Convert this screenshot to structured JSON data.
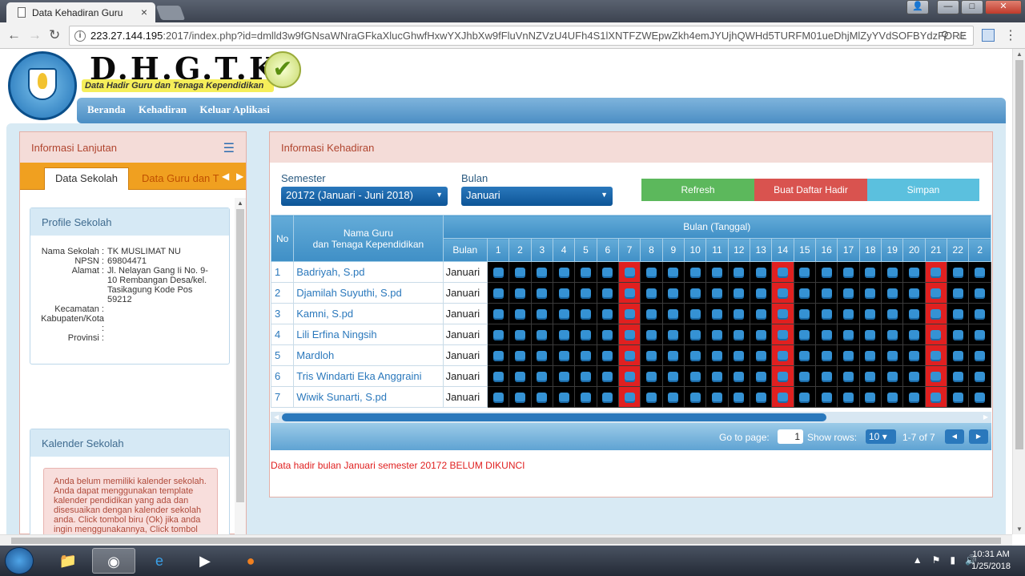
{
  "browser": {
    "tab_title": "Data Kehadiran Guru",
    "tab_close": "×",
    "url_host": "223.27.144.195",
    "url_rest": ":2017/index.php?id=dmlld3w9fGNsaWNraGFkaXlucGhwfHxwYXJhbXw9fFluVnNZVzU4UFh4S1lXNTFZWEpwZkh4emJYUjhQWHd5TURFM01ueDhjMlZyYVdSOFBYdzFORE",
    "window_min": "—",
    "window_max": "□",
    "window_close": "✕"
  },
  "header": {
    "brand_title": "D.H.G.T.K",
    "brand_subtitle": "Data Hadir Guru dan Tenaga Kependidikan",
    "nav": [
      "Beranda",
      "Kehadiran",
      "Keluar Aplikasi"
    ]
  },
  "left_panel": {
    "title": "Informasi Lanjutan",
    "tabs": [
      "Data Sekolah",
      "Data Guru dan T"
    ],
    "profile": {
      "title": "Profile Sekolah",
      "rows": [
        {
          "label": "Nama Sekolah :",
          "value": "TK MUSLIMAT NU"
        },
        {
          "label": "NPSN :",
          "value": "69804471"
        },
        {
          "label": "Alamat :",
          "value": "Jl. Nelayan Gang Ii No. 9-10 Rembangan Desa/kel. Tasikagung Kode Pos 59212"
        },
        {
          "label": "Kecamatan :",
          "value": ""
        },
        {
          "label": "Kabupaten/Kota :",
          "value": ""
        },
        {
          "label": "Provinsi :",
          "value": ""
        }
      ]
    },
    "calendar": {
      "title": "Kalender Sekolah",
      "alert": "Anda belum memiliki kalender sekolah. Anda dapat menggunakan template kalender pendidikan yang ada dan disesuaikan dengan kalender sekolah anda. Click tombol biru (Ok) jika anda ingin menggunakannya, Click tombol merah (Hapus) jika anda tidak mau menggunakannya."
    }
  },
  "right_panel": {
    "title": "Informasi Kehadiran",
    "semester_label": "Semester",
    "semester_value": "20172 (Januari - Juni 2018)",
    "bulan_label": "Bulan",
    "bulan_value": "Januari",
    "buttons": {
      "refresh": "Refresh",
      "buat": "Buat Daftar Hadir",
      "simpan": "Simpan"
    },
    "colors": {
      "refresh": "#5cb85c",
      "buat": "#d9534f",
      "simpan": "#5bc0de",
      "holiday": "#e02020",
      "present_dot": "#3592d4"
    },
    "grid": {
      "col_no": "No",
      "col_name_1": "Nama Guru",
      "col_name_2": "dan Tenaga Kependidikan",
      "col_bulan_group": "Bulan (Tanggal)",
      "col_bulan": "Bulan",
      "days": [
        "1",
        "2",
        "3",
        "4",
        "5",
        "6",
        "7",
        "8",
        "9",
        "10",
        "11",
        "12",
        "13",
        "14",
        "15",
        "16",
        "17",
        "18",
        "19",
        "20",
        "21",
        "22",
        "2"
      ],
      "holiday_days": [
        7,
        14,
        21
      ],
      "rows": [
        {
          "no": "1",
          "name": "Badriyah, S.pd",
          "bulan": "Januari"
        },
        {
          "no": "2",
          "name": "Djamilah Suyuthi, S.pd",
          "bulan": "Januari"
        },
        {
          "no": "3",
          "name": "Kamni, S.pd",
          "bulan": "Januari"
        },
        {
          "no": "4",
          "name": "Lili Erfina Ningsih",
          "bulan": "Januari"
        },
        {
          "no": "5",
          "name": "Mardloh",
          "bulan": "Januari"
        },
        {
          "no": "6",
          "name": "Tris Windarti Eka Anggraini",
          "bulan": "Januari"
        },
        {
          "no": "7",
          "name": "Wiwik Sunarti, S.pd",
          "bulan": "Januari"
        }
      ]
    },
    "pager": {
      "goto_label": "Go to page:",
      "page": "1",
      "show_rows_label": "Show rows:",
      "rows_value": "10",
      "range": "1-7 of 7"
    },
    "status_message": "Data hadir bulan Januari semester 20172 BELUM DIKUNCI"
  },
  "taskbar": {
    "time": "10:31 AM",
    "date": "1/25/2018"
  }
}
